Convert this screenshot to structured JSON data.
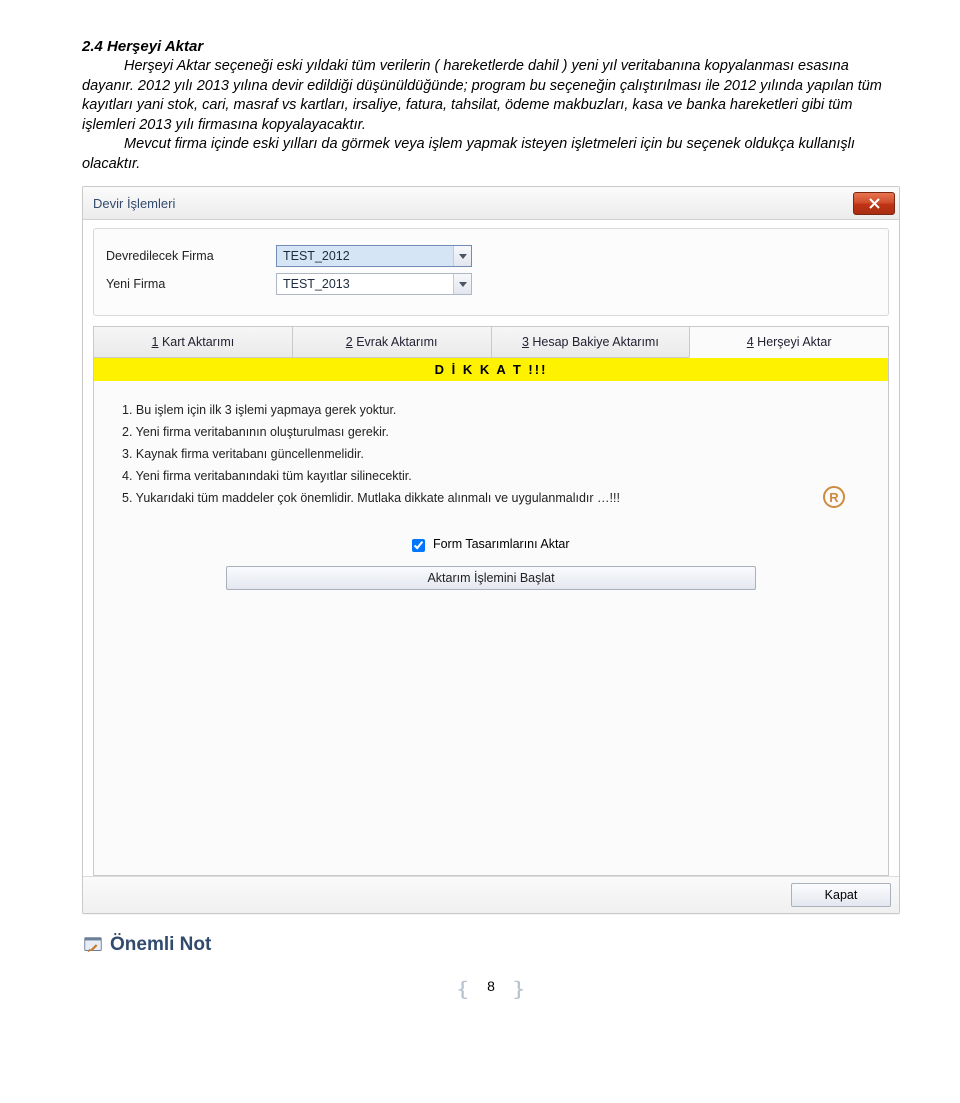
{
  "section": {
    "title": "2.4 Herşeyi Aktar",
    "p1": "Herşeyi Aktar seçeneği eski yıldaki tüm verilerin ( hareketlerde dahil ) yeni yıl veritabanına kopyalanması esasına dayanır. 2012 yılı 2013 yılına devir edildiği düşünüldüğünde; program bu seçeneğin çalıştırılması ile 2012 yılında yapılan tüm kayıtları yani stok, cari, masraf vs kartları, irsaliye, fatura, tahsilat, ödeme makbuzları, kasa ve banka hareketleri gibi tüm işlemleri 2013 yılı firmasına kopyalayacaktır.",
    "p2": "Mevcut firma içinde eski yılları da görmek veya işlem yapmak isteyen işletmeleri için bu seçenek oldukça kullanışlı olacaktır."
  },
  "window": {
    "title": "Devir İşlemleri",
    "form": {
      "row1_label": "Devredilecek Firma",
      "row1_value": "TEST_2012",
      "row2_label": "Yeni Firma",
      "row2_value": "TEST_2013"
    },
    "tabs": {
      "t1_key": "1",
      "t1_label": " Kart Aktarımı",
      "t2_key": "2",
      "t2_label": " Evrak Aktarımı",
      "t3_key": "3",
      "t3_label": " Hesap Bakiye Aktarımı",
      "t4_key": "4",
      "t4_label": " Herşeyi Aktar"
    },
    "dikkat": "D İ K K A T !!!",
    "notices": {
      "n1": "1.  Bu işlem için ilk 3 işlemi yapmaya gerek yoktur.",
      "n2": "2.  Yeni firma veritabanının oluşturulması gerekir.",
      "n3": "3.  Kaynak firma veritabanı güncellenmelidir.",
      "n4": "4.  Yeni firma veritabanındaki tüm kayıtlar silinecektir.",
      "n5": "5.  Yukarıdaki tüm maddeler çok önemlidir. Mutlaka dikkate alınmalı ve uygulanmalıdır …!!!"
    },
    "check_label": "Form Tasarımlarını Aktar",
    "start_label": "Aktarım İşlemini Başlat",
    "close_label": "Kapat"
  },
  "note_icon_label": "Önemli Not",
  "page_number": "8"
}
